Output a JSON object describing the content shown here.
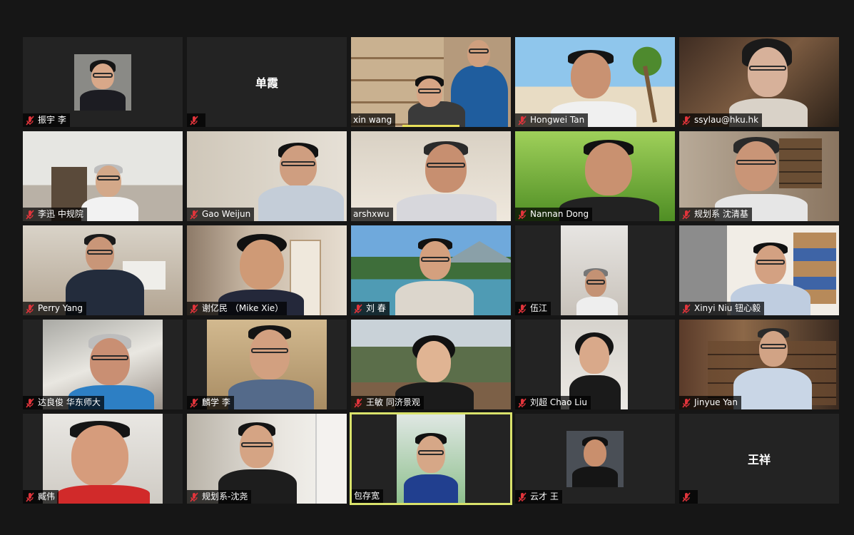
{
  "participants": [
    {
      "name": "振宇 李"
    },
    {
      "name": "单霞"
    },
    {
      "name": "xin wang"
    },
    {
      "name": "Hongwei Tan"
    },
    {
      "name": "ssylau@hku.hk"
    },
    {
      "name": "李迅 中规院"
    },
    {
      "name": "Gao Weijun"
    },
    {
      "name": "arshxwu"
    },
    {
      "name": "Nannan Dong"
    },
    {
      "name": "规划系 沈清基"
    },
    {
      "name": "Perry Yang"
    },
    {
      "name": "谢亿民 （Mike Xie）"
    },
    {
      "name": "刘 春"
    },
    {
      "name": "伍江"
    },
    {
      "name": "Xinyi Niu 钮心毅"
    },
    {
      "name": "达良俊 华东师大"
    },
    {
      "name": "麟学 李"
    },
    {
      "name": "王敏 同济景观"
    },
    {
      "name": "刘超 Chao Liu"
    },
    {
      "name": "Jinyue Yan"
    },
    {
      "name": "臧伟"
    },
    {
      "name": "规划系-沈尧"
    },
    {
      "name": "包存宽"
    },
    {
      "name": "云才 王"
    },
    {
      "name": "王祥"
    }
  ],
  "colors": {
    "active_speaker_border": "#d9e26b",
    "muted_icon": "#e0343b",
    "tile_bg": "#232323"
  }
}
